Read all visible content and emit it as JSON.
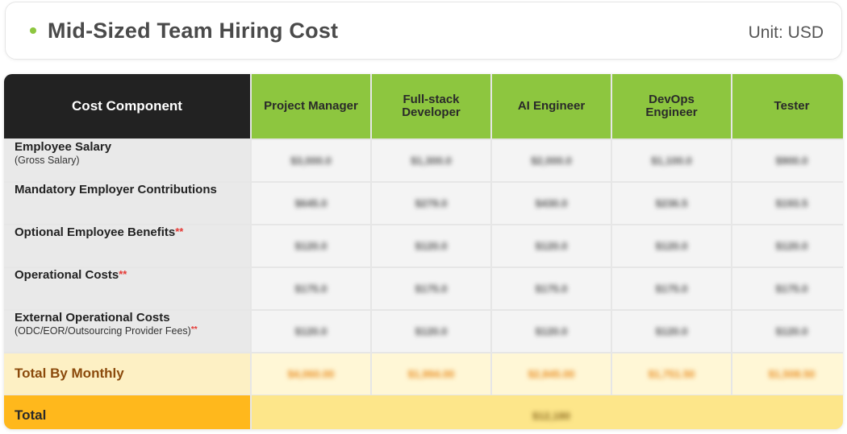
{
  "header": {
    "title": "Mid-Sized Team Hiring Cost",
    "unit": "Unit: USD",
    "accent": "#8dc63f"
  },
  "table": {
    "corner_label": "Cost Component",
    "columns": [
      "Project Manager",
      "Full-stack Developer",
      "AI Engineer",
      "DevOps Engineer",
      "Tester"
    ],
    "rows": [
      {
        "label": "Employee Salary",
        "sub": "(Gross Salary)",
        "star": "",
        "values": [
          "$3,000.0",
          "$1,300.0",
          "$2,000.0",
          "$1,100.0",
          "$900.0"
        ]
      },
      {
        "label": "Mandatory Employer Contributions",
        "sub": "",
        "star": "",
        "values": [
          "$645.0",
          "$279.0",
          "$430.0",
          "$236.5",
          "$193.5"
        ]
      },
      {
        "label": "Optional Employee Benefits",
        "sub": "",
        "star": "**",
        "values": [
          "$120.0",
          "$120.0",
          "$120.0",
          "$120.0",
          "$120.0"
        ]
      },
      {
        "label": "Operational Costs",
        "sub": "",
        "star": "**",
        "values": [
          "$175.0",
          "$175.0",
          "$175.0",
          "$175.0",
          "$175.0"
        ]
      },
      {
        "label": "External Operational Costs",
        "sub": "(ODC/EOR/Outsourcing Provider Fees)",
        "star": "**",
        "values": [
          "$120.0",
          "$120.0",
          "$120.0",
          "$120.0",
          "$120.0"
        ]
      }
    ],
    "monthly": {
      "label": "Total By Monthly",
      "values": [
        "$4,060.00",
        "$1,994.00",
        "$2,845.00",
        "$1,751.50",
        "$1,508.50"
      ]
    },
    "total": {
      "label": "Total",
      "value": "$12,180"
    }
  },
  "colors": {
    "header_dark": "#222222",
    "header_green": "#8dc63f",
    "monthly_bg": "#fdf0c4",
    "total_label_bg": "#ffb81c",
    "total_value_bg": "#fde68a"
  }
}
